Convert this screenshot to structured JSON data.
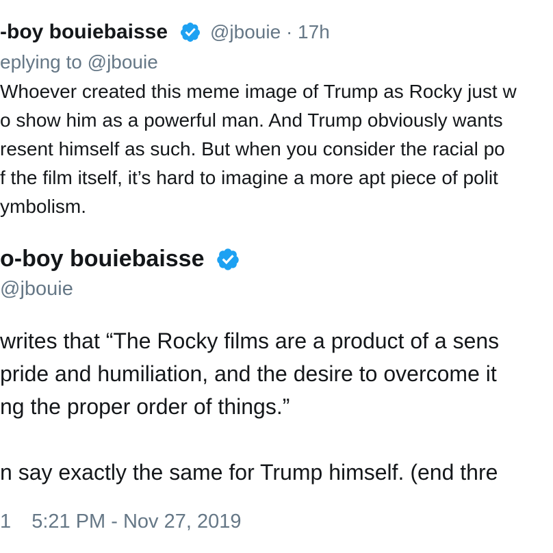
{
  "reply_tweet": {
    "display_name": "-boy bouiebaisse",
    "handle": "@jbouie",
    "separator": "·",
    "time": "17h",
    "replying_to": "eplying to @jbouie",
    "body_lines": [
      "Whoever created this meme image of Trump as Rocky just w",
      "o show him as a powerful man. And Trump obviously wants",
      "resent himself as such. But when you consider the racial po",
      "f the film itself, it’s hard to imagine a more apt piece of polit",
      "ymbolism."
    ]
  },
  "main_tweet": {
    "display_name": "o-boy bouiebaisse",
    "handle": "@jbouie",
    "body_lines": [
      "writes that “The Rocky films are a product of a sens",
      "pride and humiliation, and the desire to overcome it",
      "ng the proper order of things.”",
      "",
      "n say exactly the same for Trump himself. (end thre"
    ],
    "footer_count": "1",
    "timestamp": "5:21 PM - Nov 27, 2019"
  },
  "colors": {
    "text": "#14171a",
    "muted": "#657786",
    "verified_badge": "#1da1f2"
  },
  "icons": {
    "verified": "verified-badge-icon"
  }
}
